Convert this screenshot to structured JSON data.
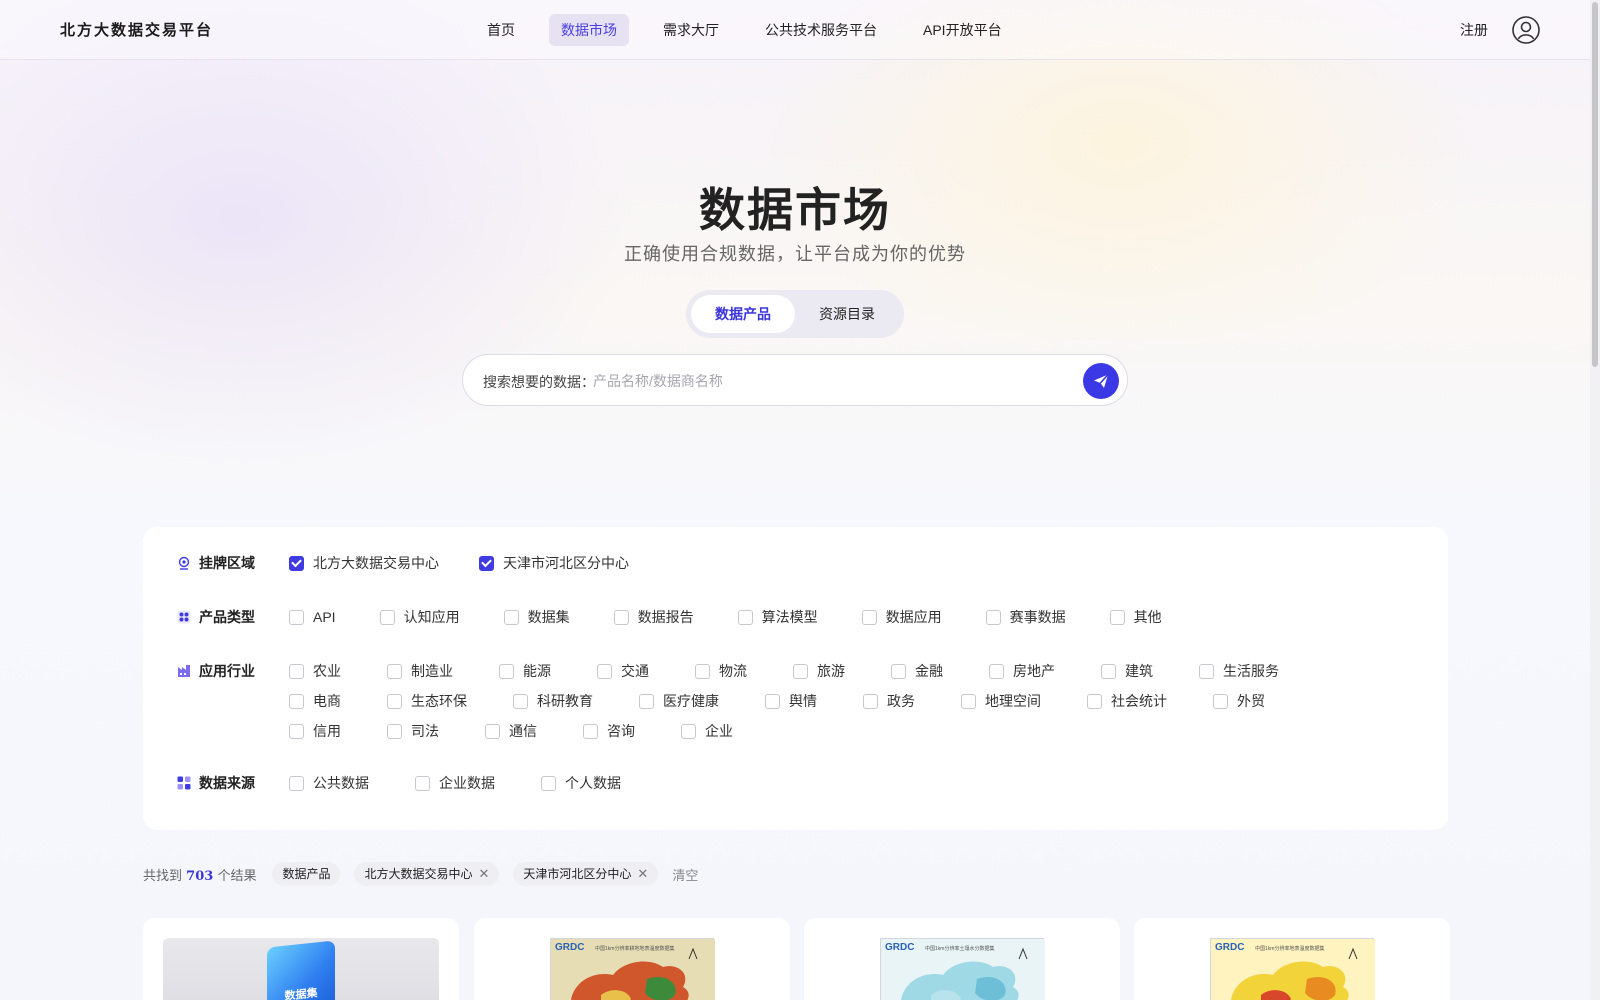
{
  "header": {
    "logo": "北方大数据交易平台",
    "nav": [
      "首页",
      "数据市场",
      "需求大厅",
      "公共技术服务平台",
      "API开放平台"
    ],
    "active_nav": "数据市场",
    "register": "注册",
    "avatar_icon": "user-circle-icon"
  },
  "hero": {
    "title": "数据市场",
    "subtitle": "正确使用合规数据，让平台成为你的优势",
    "tabs": [
      "数据产品",
      "资源目录"
    ],
    "active_tab": "数据产品"
  },
  "search": {
    "prefix": "搜索想要的数据：",
    "placeholder": "产品名称/数据商名称",
    "value": "",
    "button_icon": "send-icon"
  },
  "filters": {
    "region": {
      "label": "挂牌区域",
      "icon": "location-icon",
      "options": [
        {
          "label": "北方大数据交易中心",
          "checked": true
        },
        {
          "label": "天津市河北区分中心",
          "checked": true
        }
      ]
    },
    "product_type": {
      "label": "产品类型",
      "icon": "grid-icon",
      "options": [
        {
          "label": "API",
          "checked": false
        },
        {
          "label": "认知应用",
          "checked": false
        },
        {
          "label": "数据集",
          "checked": false
        },
        {
          "label": "数据报告",
          "checked": false
        },
        {
          "label": "算法模型",
          "checked": false
        },
        {
          "label": "数据应用",
          "checked": false
        },
        {
          "label": "赛事数据",
          "checked": false
        },
        {
          "label": "其他",
          "checked": false
        }
      ]
    },
    "industry": {
      "label": "应用行业",
      "icon": "industry-icon",
      "options": [
        {
          "label": "农业",
          "checked": false
        },
        {
          "label": "制造业",
          "checked": false
        },
        {
          "label": "能源",
          "checked": false
        },
        {
          "label": "交通",
          "checked": false
        },
        {
          "label": "物流",
          "checked": false
        },
        {
          "label": "旅游",
          "checked": false
        },
        {
          "label": "金融",
          "checked": false
        },
        {
          "label": "房地产",
          "checked": false
        },
        {
          "label": "建筑",
          "checked": false
        },
        {
          "label": "生活服务",
          "checked": false
        },
        {
          "label": "电商",
          "checked": false
        },
        {
          "label": "生态环保",
          "checked": false
        },
        {
          "label": "科研教育",
          "checked": false
        },
        {
          "label": "医疗健康",
          "checked": false
        },
        {
          "label": "舆情",
          "checked": false
        },
        {
          "label": "政务",
          "checked": false
        },
        {
          "label": "地理空间",
          "checked": false
        },
        {
          "label": "社会统计",
          "checked": false
        },
        {
          "label": "外贸",
          "checked": false
        },
        {
          "label": "信用",
          "checked": false
        },
        {
          "label": "司法",
          "checked": false
        },
        {
          "label": "通信",
          "checked": false
        },
        {
          "label": "咨询",
          "checked": false
        },
        {
          "label": "企业",
          "checked": false
        }
      ]
    },
    "source": {
      "label": "数据来源",
      "icon": "apps-icon",
      "options": [
        {
          "label": "公共数据",
          "checked": false
        },
        {
          "label": "企业数据",
          "checked": false
        },
        {
          "label": "个人数据",
          "checked": false
        }
      ]
    }
  },
  "results": {
    "prefix": "共找到",
    "count": "703",
    "suffix": "个结果",
    "chips": [
      {
        "label": "数据产品",
        "removable": false
      },
      {
        "label": "北方大数据交易中心",
        "removable": true
      },
      {
        "label": "天津市河北区分中心",
        "removable": true
      }
    ],
    "clear": "清空"
  },
  "cards": [
    {
      "thumb": "cube",
      "cube_text": "数据集"
    },
    {
      "thumb": "map",
      "brand": "GRDC",
      "caption": "中国1km分辨率耕地地表温度数据集",
      "palette": [
        "#e7ddb4",
        "#d0562c",
        "#3d8a3a",
        "#e9c04a"
      ]
    },
    {
      "thumb": "map",
      "brand": "GRDC",
      "caption": "中国1km分辨率土壤水分数据集",
      "palette": [
        "#e9f4f6",
        "#9fd9e6",
        "#6cbfd7",
        "#b8e3ec"
      ]
    },
    {
      "thumb": "map",
      "brand": "GRDC",
      "caption": "中国1km分辨率地表温度数据集",
      "palette": [
        "#fff3c0",
        "#f2d33a",
        "#e88c22",
        "#d8472a"
      ]
    }
  ],
  "colors": {
    "accent": "#3b38e6",
    "active_nav_bg": "#e6e2f1",
    "checkbox_checked": "#3f3be0"
  }
}
